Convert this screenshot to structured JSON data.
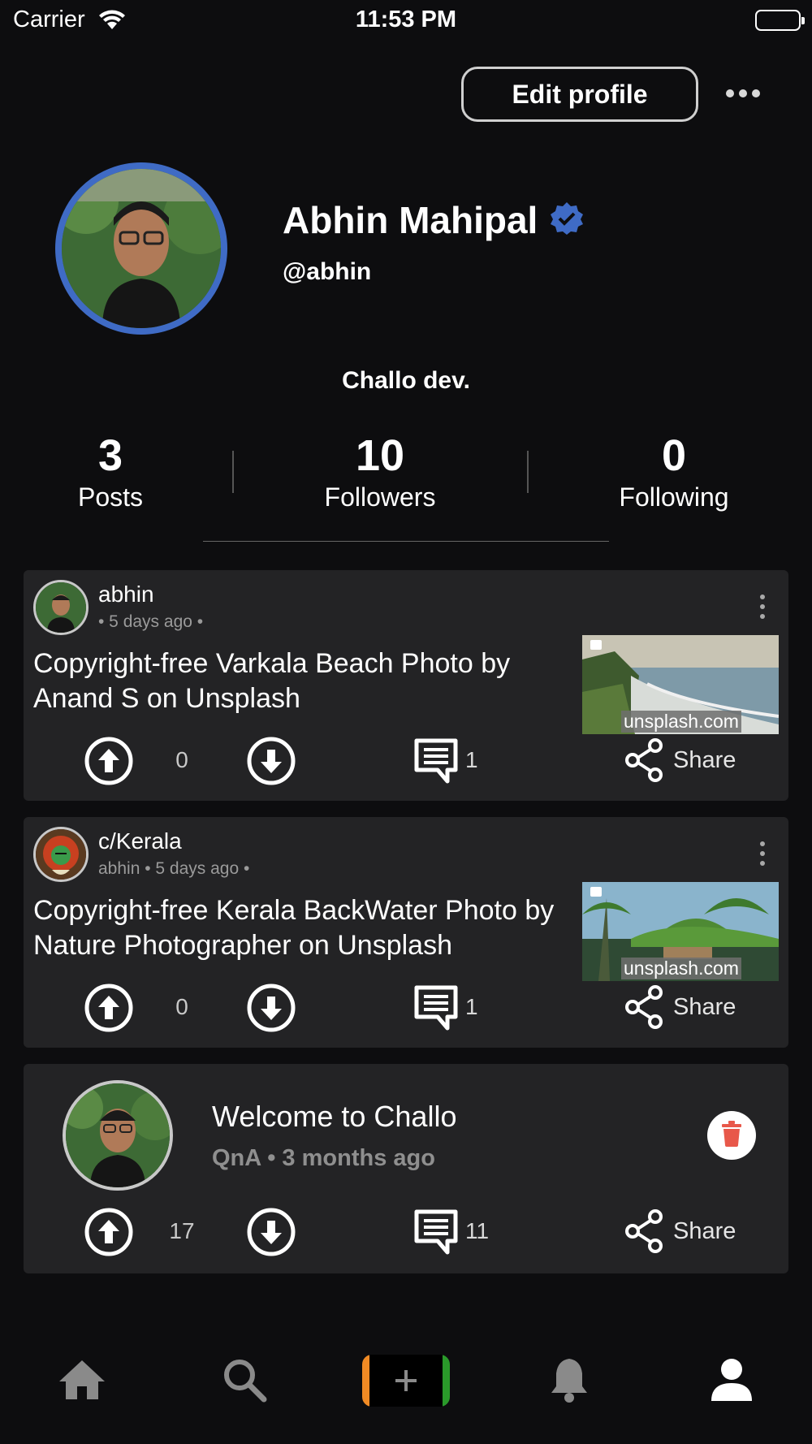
{
  "status_bar": {
    "carrier": "Carrier",
    "time": "11:53 PM"
  },
  "header": {
    "edit_profile_label": "Edit profile"
  },
  "profile": {
    "name": "Abhin Mahipal",
    "handle": "@abhin",
    "bio": "Challo dev.",
    "verified": true,
    "verified_color": "#3f6bc5"
  },
  "stats": [
    {
      "value": "3",
      "label": "Posts"
    },
    {
      "value": "10",
      "label": "Followers"
    },
    {
      "value": "0",
      "label": "Following"
    }
  ],
  "posts": [
    {
      "author": "abhin",
      "meta": "• 5 days ago •",
      "title": "Copyright-free Varkala Beach Photo by Anand S on Unsplash",
      "thumb_label": "unsplash.com",
      "votes": "0",
      "comments": "1",
      "share_label": "Share"
    },
    {
      "author": "c/Kerala",
      "meta": "abhin • 5 days ago •",
      "title": "Copyright-free Kerala BackWater Photo by Nature Photographer on Unsplash",
      "thumb_label": "unsplash.com",
      "votes": "0",
      "comments": "1",
      "share_label": "Share"
    }
  ],
  "qna_post": {
    "title": "Welcome to Challo",
    "category": "QnA",
    "separator": "•",
    "time": "3 months ago",
    "votes": "17",
    "comments": "11",
    "share_label": "Share"
  },
  "bottom_nav": {
    "items": [
      "home-icon",
      "search-icon",
      "create-post-icon",
      "notifications-icon",
      "profile-icon"
    ],
    "active": "profile-icon"
  },
  "colors": {
    "background": "#0d0d0f",
    "card": "#232325",
    "accent_blue": "#3f6bc5",
    "delete_red": "#e8584a",
    "create_orange": "#f08a24",
    "create_green": "#2a9a2a"
  }
}
